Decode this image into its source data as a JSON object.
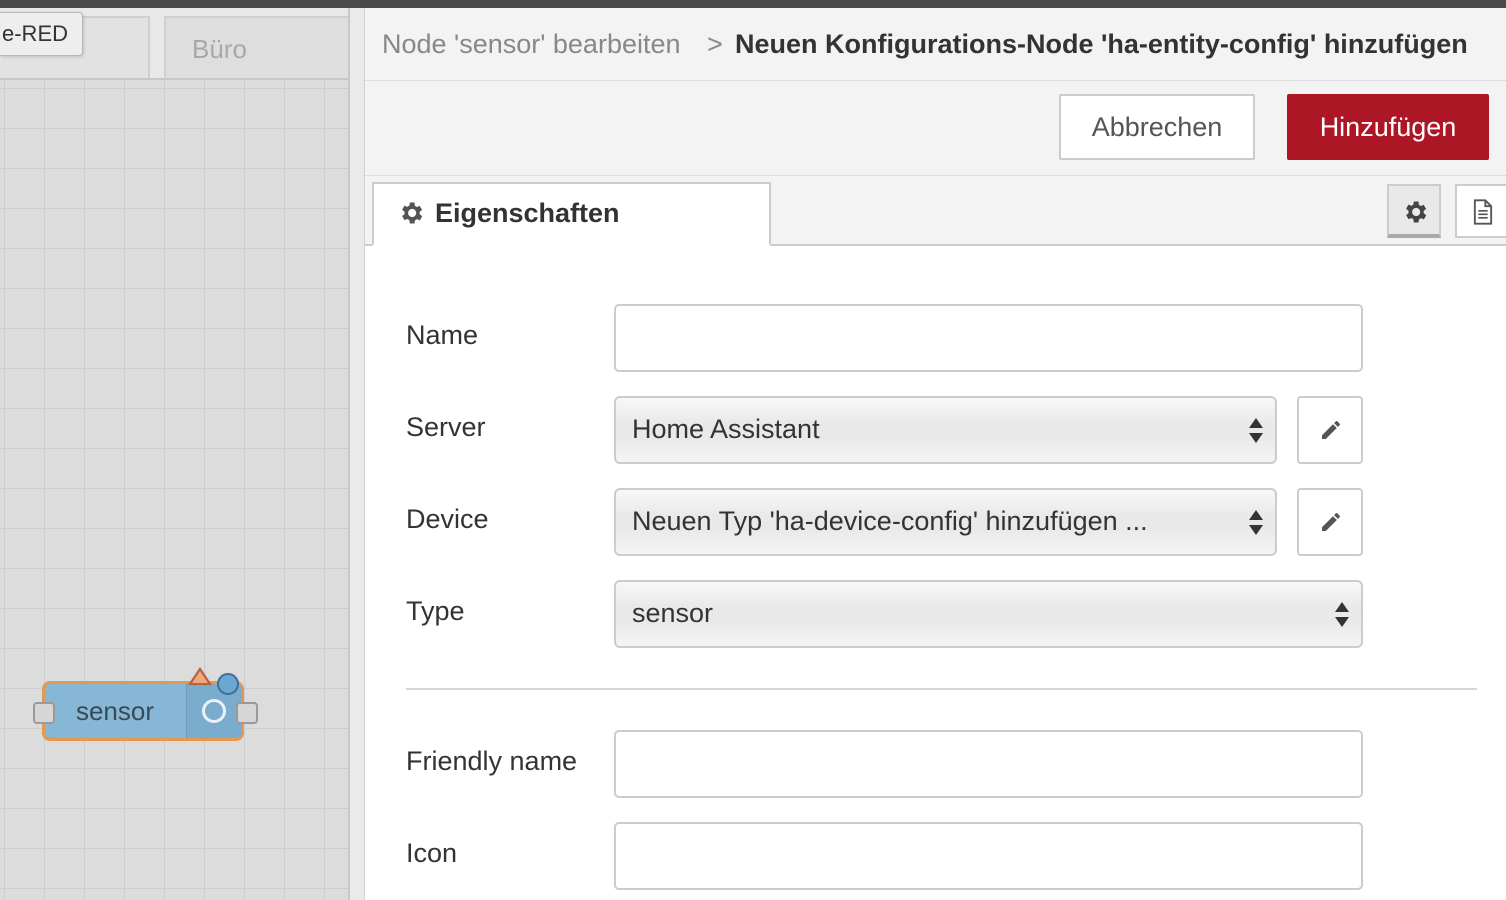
{
  "workspace": {
    "app_title_fragment": "e-RED",
    "tabs": [
      {
        "label": ""
      },
      {
        "label": "Büro"
      }
    ],
    "node": {
      "label": "sensor"
    }
  },
  "tray": {
    "breadcrumb": {
      "previous": "Node 'sensor' bearbeiten",
      "separator": ">",
      "current": "Neuen Konfigurations-Node 'ha-entity-config' hinzufügen"
    },
    "toolbar": {
      "cancel_label": "Abbrechen",
      "add_label": "Hinzufügen"
    },
    "tabs": {
      "properties_label": "Eigenschaften"
    },
    "form": {
      "name": {
        "label": "Name",
        "value": ""
      },
      "server": {
        "label": "Server",
        "selected": "Home Assistant"
      },
      "device": {
        "label": "Device",
        "selected": "Neuen Typ 'ha-device-config' hinzufügen ..."
      },
      "type": {
        "label": "Type",
        "selected": "sensor"
      },
      "friendly_name": {
        "label": "Friendly name",
        "value": ""
      },
      "icon": {
        "label": "Icon",
        "value": ""
      }
    }
  },
  "colors": {
    "primary_button": "#ad1625",
    "node_fill": "#87b7d6",
    "node_border": "#e39a4f"
  },
  "icons": [
    "gear-icon",
    "document-icon",
    "pencil-icon",
    "warning-triangle-icon",
    "changed-dot-icon",
    "select-arrows-icon"
  ]
}
